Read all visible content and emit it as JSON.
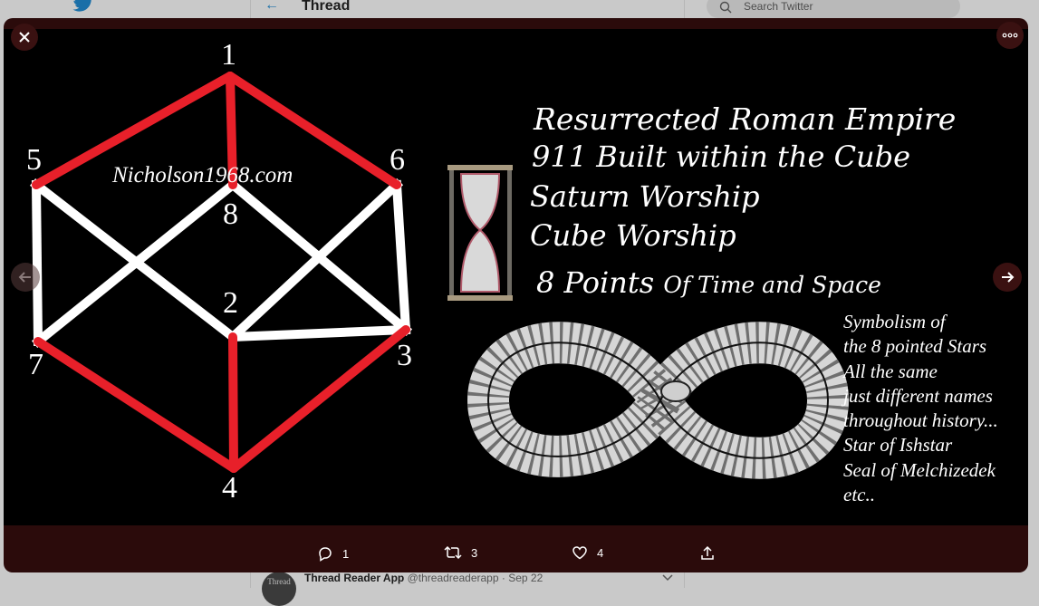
{
  "background": {
    "header_title": "Thread",
    "search_placeholder": "Search Twitter",
    "avatar_text": "Thread",
    "author_name": "Thread Reader App",
    "author_handle": "@threadreaderapp",
    "date_sep": "·",
    "date": "Sep 22"
  },
  "image": {
    "vertices": [
      "1",
      "5",
      "6",
      "8",
      "2",
      "7",
      "3",
      "4"
    ],
    "site": "Nicholson1968.com",
    "headlines": [
      "Resurrected Roman Empire",
      "911 Built within the Cube",
      "Saturn Worship",
      "Cube Worship"
    ],
    "points_main": "8 Points ",
    "points_small": "Of Time and Space",
    "symbolism_lines": [
      "Symbolism of",
      "the 8 pointed Stars",
      "All the same",
      "just different names",
      "throughout history...",
      "Star of Ishstar",
      "Seal of Melchizedek",
      "etc.."
    ]
  },
  "actions": {
    "reply_count": "1",
    "retweet_count": "3",
    "like_count": "4"
  },
  "colors": {
    "overlay": "#2b0b0b",
    "hex_red": "#e8202a",
    "twitter_blue": "#1a6fa8"
  }
}
